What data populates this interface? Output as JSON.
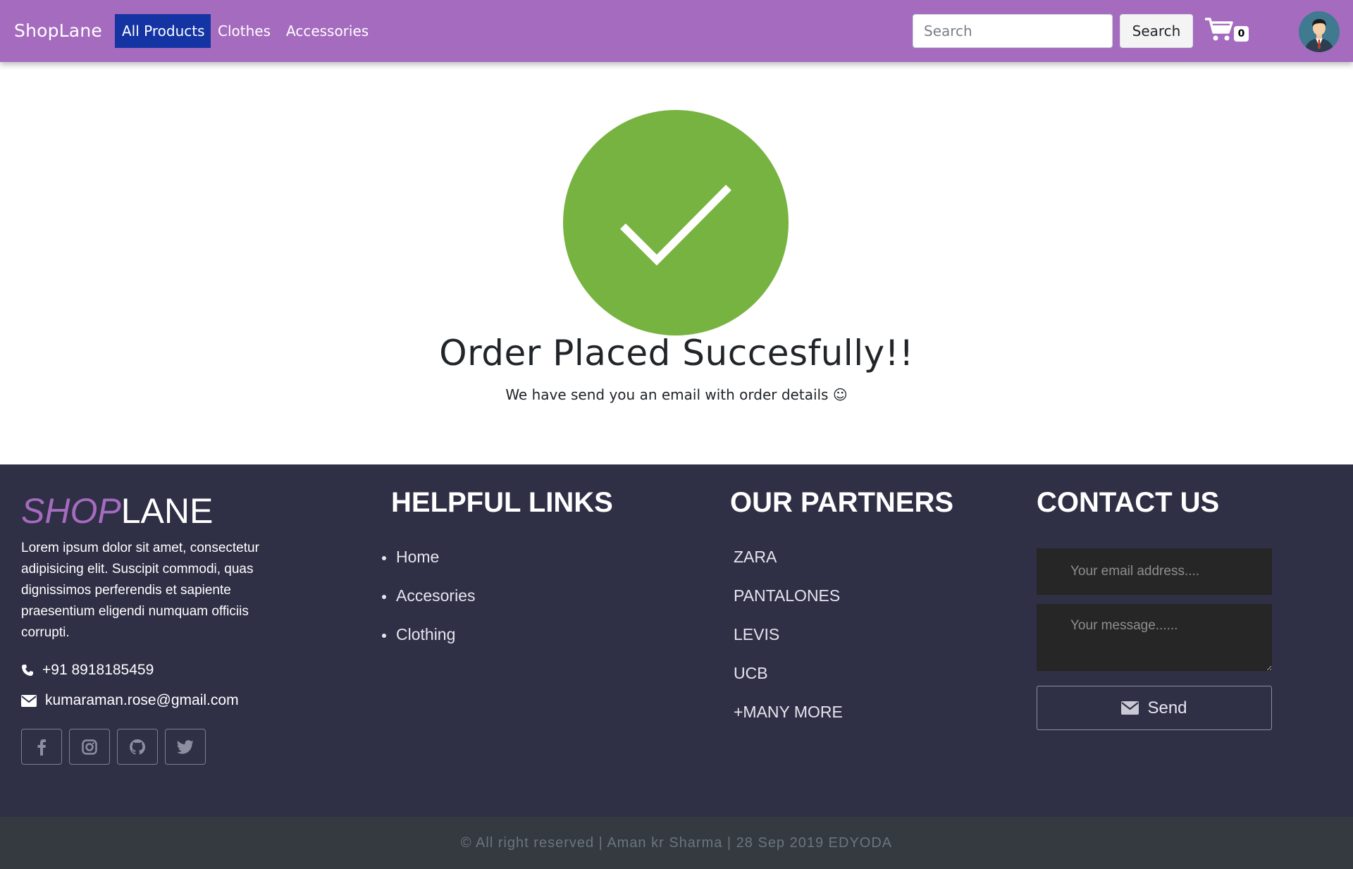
{
  "navbar": {
    "brand": "ShopLane",
    "links": [
      {
        "label": "All Products",
        "active": true
      },
      {
        "label": "Clothes",
        "active": false
      },
      {
        "label": "Accessories",
        "active": false
      }
    ],
    "search_placeholder": "Search",
    "search_button": "Search",
    "cart_count": "0",
    "colors": {
      "background": "#a56bbf",
      "active_link": "#1434a4"
    }
  },
  "success": {
    "icon": "check-circle-icon",
    "icon_color": "#77b340",
    "title": "Order Placed Succesfully!!",
    "subtitle": "We have send you an email with order details ☺"
  },
  "footer": {
    "logo": {
      "part1": "SHOP",
      "part2": "LANE"
    },
    "description": "Lorem ipsum dolor sit amet, consectetur adipisicing elit. Suscipit commodi, quas dignissimos perferendis et sapiente praesentium eligendi numquam officiis corrupti.",
    "phone": "+91 8918185459",
    "email": "kumaraman.rose@gmail.com",
    "social": [
      "facebook-icon",
      "instagram-icon",
      "github-icon",
      "twitter-icon"
    ],
    "helpful_links": {
      "heading": "HELPFUL LINKS",
      "items": [
        "Home",
        "Accesories",
        "Clothing"
      ]
    },
    "partners": {
      "heading": "OUR PARTNERS",
      "items": [
        "ZARA",
        "PANTALONES",
        "LEVIS",
        "UCB",
        "+MANY MORE"
      ]
    },
    "contact": {
      "heading": "CONTACT US",
      "email_placeholder": "Your email address....",
      "message_placeholder": "Your message......",
      "send_label": "Send"
    },
    "copyright": "© All right reserved | Aman kr Sharma | 28 Sep 2019 EDYODA",
    "colors": {
      "background": "#2f2f46",
      "copyright_bg": "#343a40",
      "logo_accent": "#a56bbf"
    }
  }
}
